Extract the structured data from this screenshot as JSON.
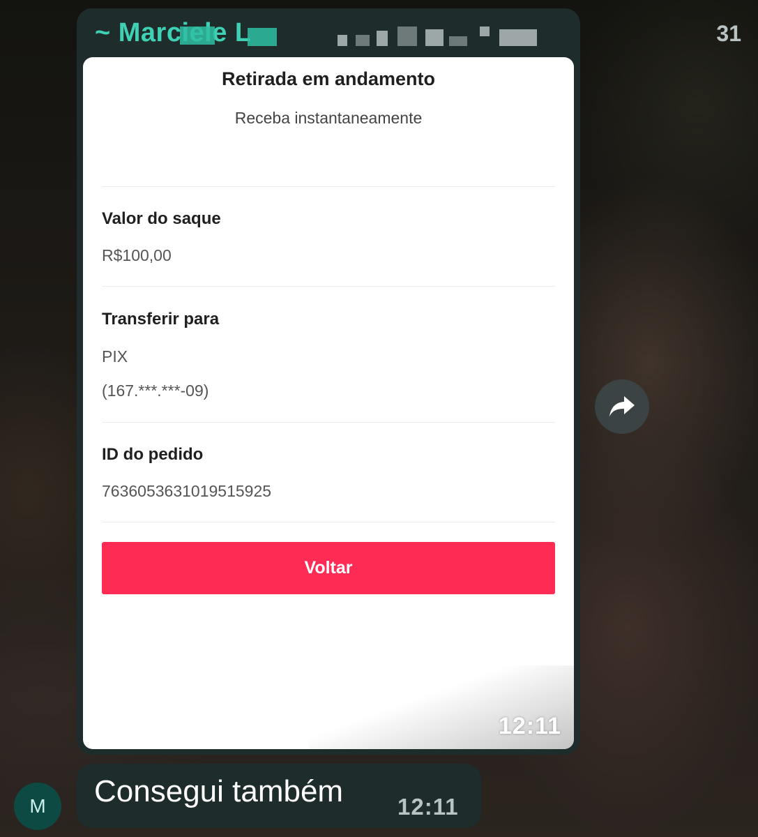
{
  "message_with_image": {
    "sender_name": "~ Marciele L",
    "sender_number_tail": "31",
    "screenshot": {
      "title": "Retirada em andamento",
      "subtitle": "Receba instantaneamente",
      "fields": [
        {
          "label": "Valor do saque",
          "values": [
            "R$100,00"
          ]
        },
        {
          "label": "Transferir para",
          "values": [
            "PIX",
            "(167.***.***-09)"
          ]
        },
        {
          "label": "ID do pedido",
          "values": [
            "7636053631019515925"
          ]
        }
      ],
      "button_label": "Voltar",
      "accent_color": "#fe2c55"
    },
    "time": "12:11"
  },
  "text_message": {
    "avatar_initial": "M",
    "text": "Consegui também",
    "time": "12:11"
  },
  "icons": {
    "forward": "forward-arrow-icon"
  }
}
